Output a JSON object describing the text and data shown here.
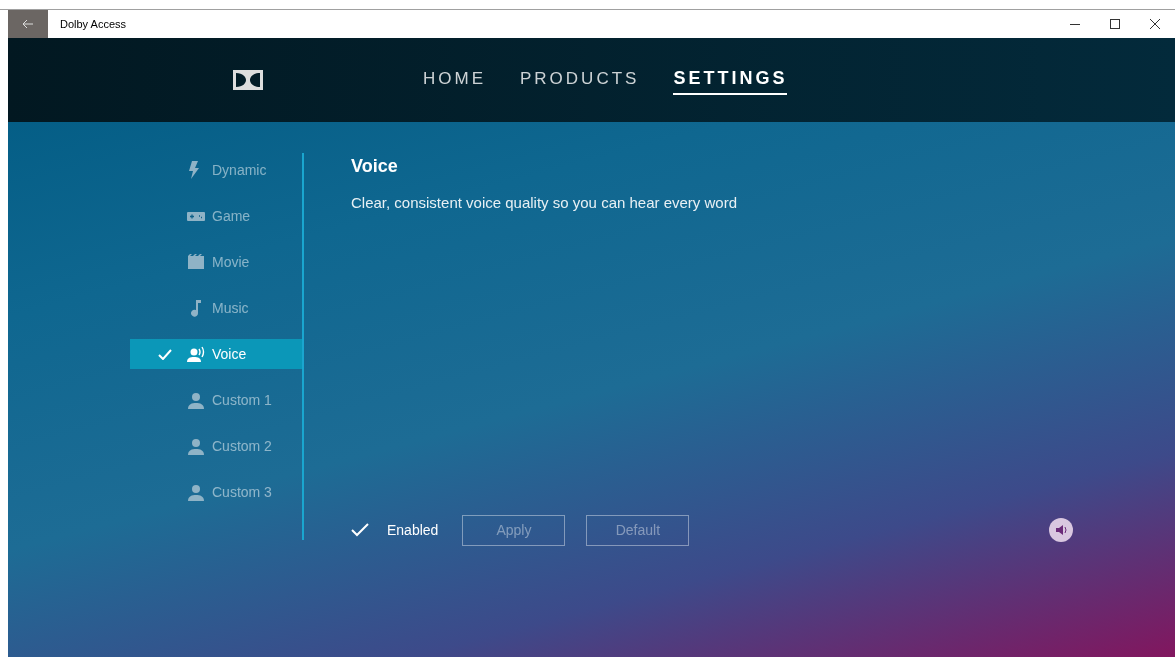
{
  "window": {
    "title": "Dolby Access"
  },
  "nav": [
    {
      "label": "HOME",
      "selected": false
    },
    {
      "label": "PRODUCTS",
      "selected": false
    },
    {
      "label": "SETTINGS",
      "selected": true
    }
  ],
  "profiles": [
    {
      "label": "Dynamic",
      "kind": "bolt",
      "selected": false
    },
    {
      "label": "Game",
      "kind": "gamepad",
      "selected": false
    },
    {
      "label": "Movie",
      "kind": "clapper",
      "selected": false
    },
    {
      "label": "Music",
      "kind": "note",
      "selected": false
    },
    {
      "label": "Voice",
      "kind": "voice",
      "selected": true
    },
    {
      "label": "Custom 1",
      "kind": "person",
      "selected": false
    },
    {
      "label": "Custom 2",
      "kind": "person",
      "selected": false
    },
    {
      "label": "Custom 3",
      "kind": "person",
      "selected": false
    }
  ],
  "detail": {
    "title": "Voice",
    "description": "Clear, consistent voice quality so you can hear every word"
  },
  "enabled": {
    "label": "Enabled",
    "checked": true
  },
  "buttons": [
    {
      "label": "Apply",
      "disabled": true
    },
    {
      "label": "Default",
      "disabled": true
    }
  ]
}
